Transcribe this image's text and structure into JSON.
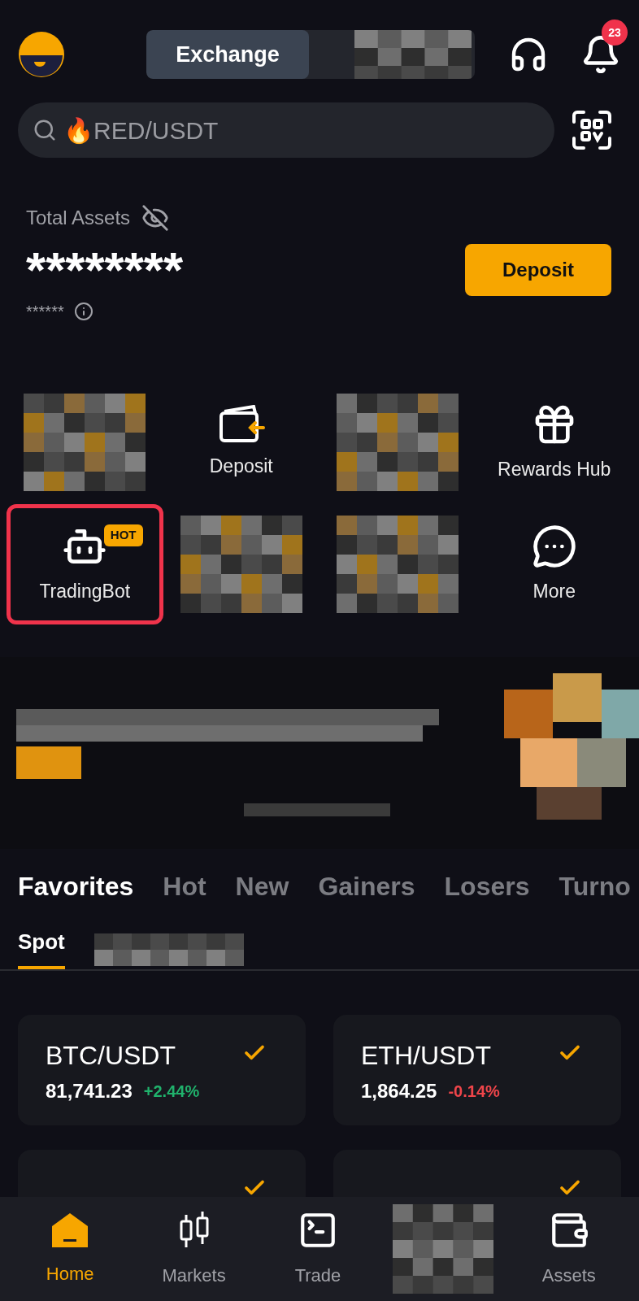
{
  "header": {
    "segments": [
      {
        "kind": "label",
        "label": "Exchange",
        "selected": true
      },
      {
        "kind": "redacted"
      }
    ],
    "notifications": "23"
  },
  "search": {
    "placeholder": "🔥RED/USDT"
  },
  "assets": {
    "label": "Total Assets",
    "balance": "********",
    "sub_balance": "******",
    "button": "Deposit"
  },
  "shortcuts": [
    {
      "kind": "redacted",
      "highlighted": false
    },
    {
      "kind": "deposit",
      "label": "Deposit",
      "highlighted": false
    },
    {
      "kind": "redacted",
      "highlighted": false
    },
    {
      "kind": "rewards",
      "label": "Rewards Hub",
      "highlighted": false
    },
    {
      "kind": "bot",
      "label": "TradingBot",
      "badge": "HOT",
      "highlighted": true
    },
    {
      "kind": "redacted",
      "highlighted": false
    },
    {
      "kind": "redacted",
      "highlighted": false
    },
    {
      "kind": "more",
      "label": "More",
      "highlighted": false
    }
  ],
  "market_tabs": [
    {
      "label": "Favorites",
      "selected": true
    },
    {
      "label": "Hot",
      "selected": false
    },
    {
      "label": "New",
      "selected": false
    },
    {
      "label": "Gainers",
      "selected": false
    },
    {
      "label": "Losers",
      "selected": false
    },
    {
      "label": "Turno",
      "selected": false
    }
  ],
  "sub_tabs": [
    {
      "kind": "label",
      "label": "Spot",
      "selected": true
    },
    {
      "kind": "redacted"
    }
  ],
  "favorites": [
    {
      "kind": "pair",
      "pair": "BTC/USDT",
      "price": "81,741.23",
      "change": "+2.44%",
      "color": "#20b26c",
      "checked": true
    },
    {
      "kind": "pair",
      "pair": "ETH/USDT",
      "price": "1,864.25",
      "change": "-0.14%",
      "color": "#ef454a",
      "checked": true
    },
    {
      "kind": "partial",
      "checked": true
    },
    {
      "kind": "partial",
      "checked": true
    }
  ],
  "nav": [
    {
      "kind": "home",
      "label": "Home",
      "selected": true
    },
    {
      "kind": "markets",
      "label": "Markets",
      "selected": false
    },
    {
      "kind": "trade",
      "label": "Trade",
      "selected": false
    },
    {
      "kind": "redacted"
    },
    {
      "kind": "assets",
      "label": "Assets",
      "selected": false
    }
  ]
}
